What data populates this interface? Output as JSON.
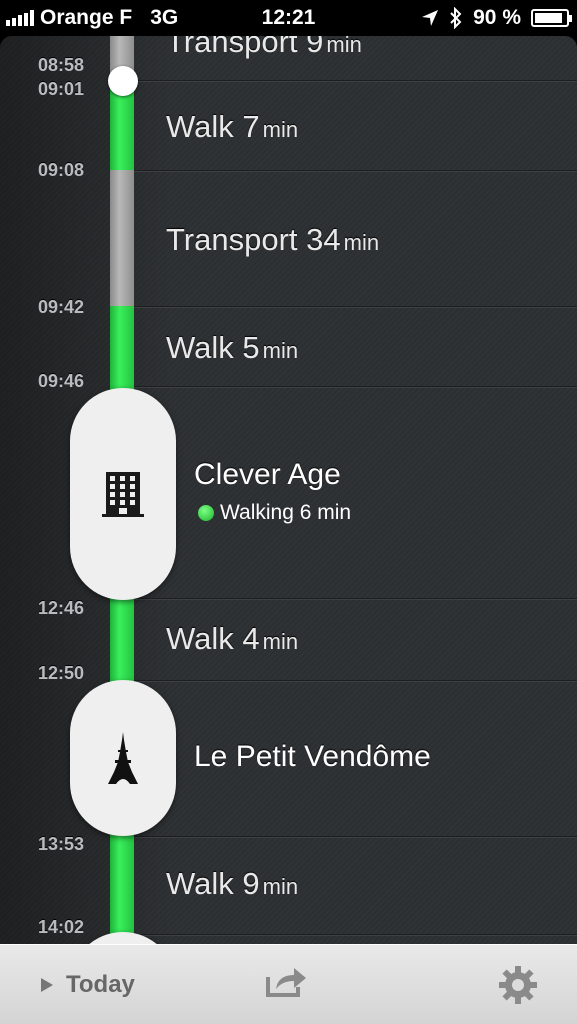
{
  "status_bar": {
    "carrier": "Orange F",
    "network": "3G",
    "time": "12:21",
    "battery": "90 %"
  },
  "timeline": {
    "times": [
      "08:58",
      "09:01",
      "09:08",
      "09:42",
      "09:46",
      "12:46",
      "12:50",
      "13:53",
      "14:02"
    ],
    "segments": [
      {
        "label": "Transport",
        "value": "9",
        "unit": "min"
      },
      {
        "label": "Walk",
        "value": "7",
        "unit": "min"
      },
      {
        "label": "Transport",
        "value": "34",
        "unit": "min"
      },
      {
        "label": "Walk",
        "value": "5",
        "unit": "min"
      },
      {
        "label": "Walk",
        "value": "4",
        "unit": "min"
      },
      {
        "label": "Walk",
        "value": "9",
        "unit": "min"
      }
    ],
    "places": [
      {
        "name": "Clever Age",
        "subtitle": "Walking 6 min",
        "icon": "building-icon"
      },
      {
        "name": "Le Petit Vendôme",
        "icon": "eiffel-tower-icon"
      }
    ]
  },
  "toolbar": {
    "today_label": "Today",
    "share_icon": "share-icon",
    "settings_icon": "gear-icon"
  },
  "colors": {
    "walk_track": "#33e553",
    "transport_track": "#a3a3a3",
    "background": "#2e3133"
  }
}
